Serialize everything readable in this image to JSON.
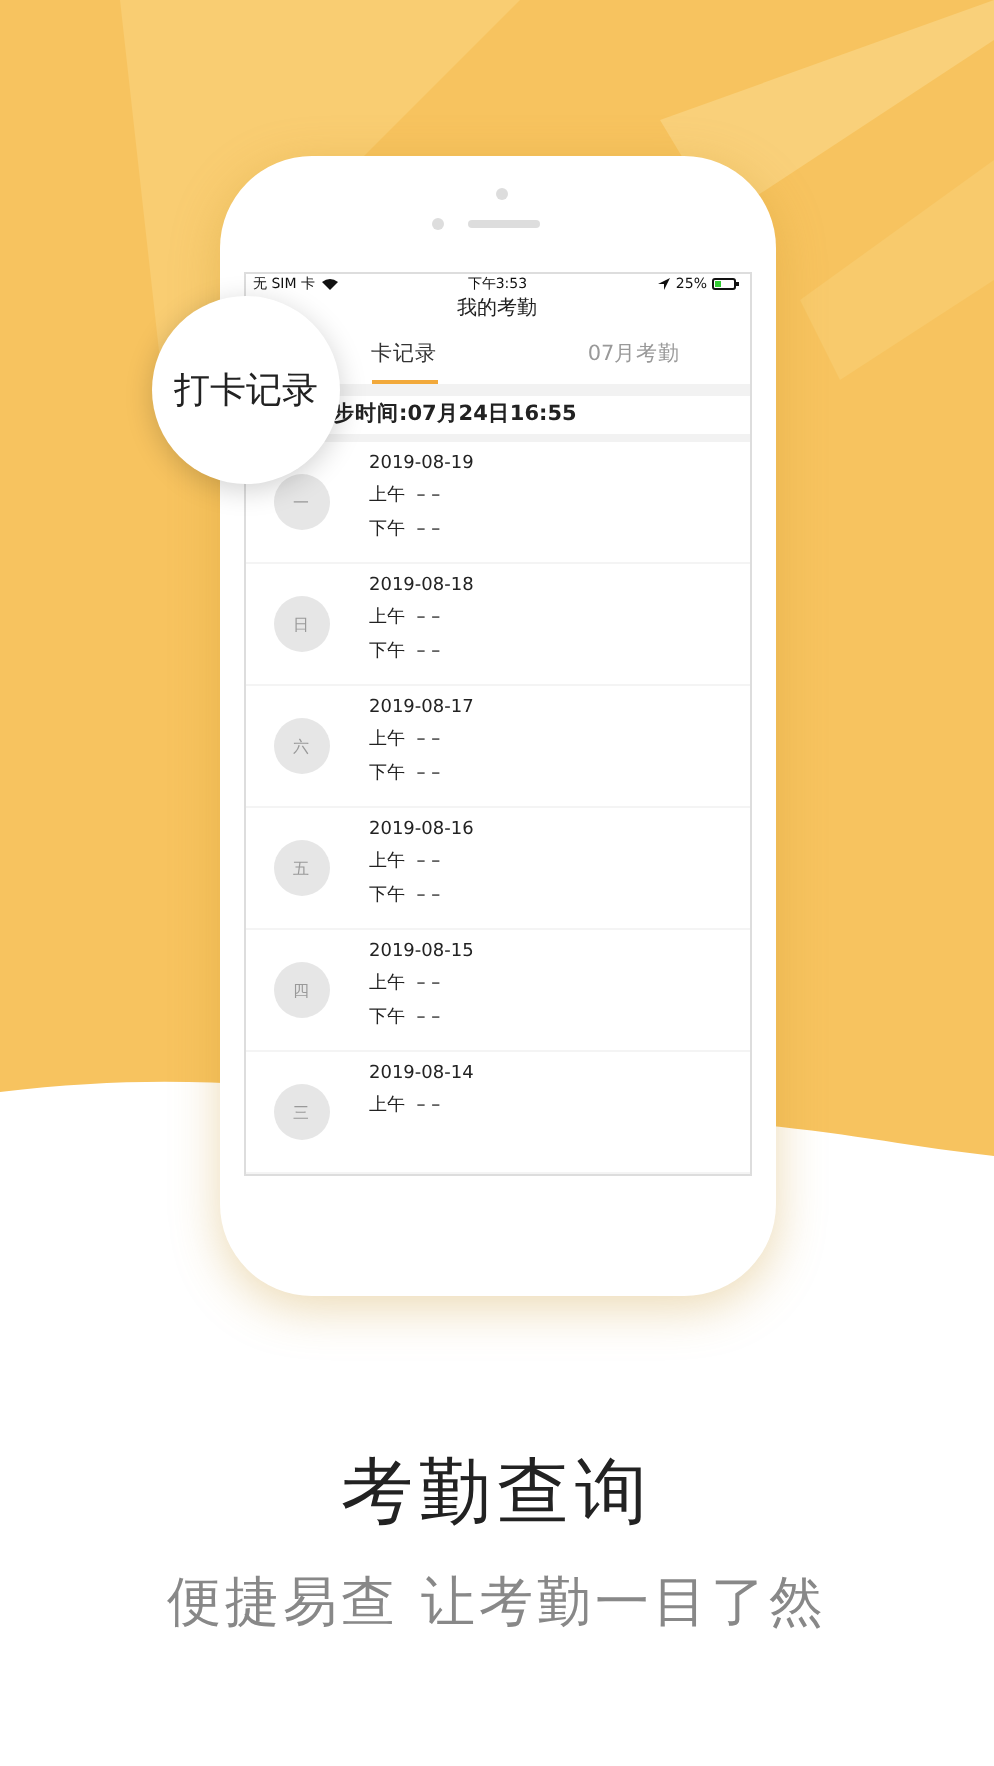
{
  "status_bar": {
    "carrier": "无 SIM 卡",
    "time": "下午3:53",
    "battery": "25%"
  },
  "nav_title": "我的考勤",
  "tabs": [
    {
      "label": "卡记录",
      "selected": true
    },
    {
      "label": "07月考勤",
      "selected": false
    }
  ],
  "sync": "步时间:07月24日16:55",
  "rows": [
    {
      "weekday": "一",
      "date": "2019-08-19",
      "am": "上午  – –",
      "pm": "下午  – –"
    },
    {
      "weekday": "日",
      "date": "2019-08-18",
      "am": "上午  – –",
      "pm": "下午  – –"
    },
    {
      "weekday": "六",
      "date": "2019-08-17",
      "am": "上午  – –",
      "pm": "下午  – –"
    },
    {
      "weekday": "五",
      "date": "2019-08-16",
      "am": "上午  – –",
      "pm": "下午  – –"
    },
    {
      "weekday": "四",
      "date": "2019-08-15",
      "am": "上午  – –",
      "pm": "下午  – –"
    },
    {
      "weekday": "三",
      "date": "2019-08-14",
      "am": "上午  – –"
    }
  ],
  "magnifier": "打卡记录",
  "headline": "考勤查询",
  "subtitle": "便捷易查 让考勤一目了然"
}
